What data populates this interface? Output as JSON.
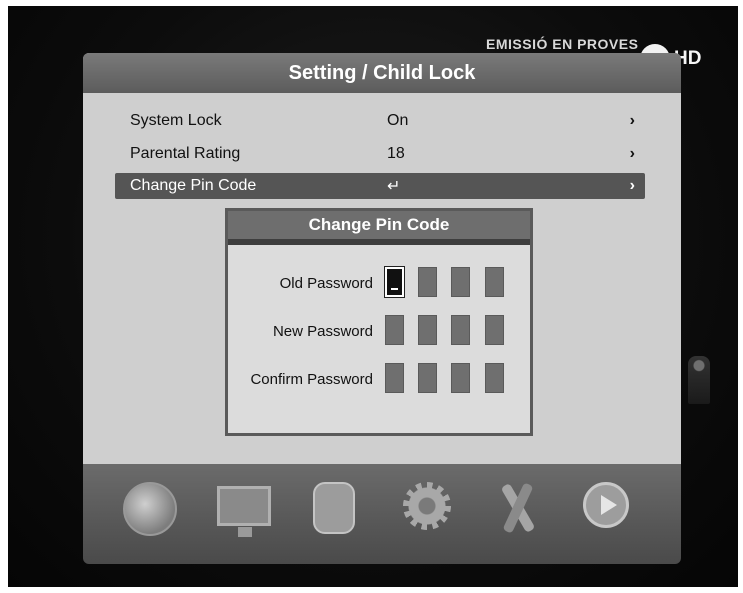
{
  "broadcast_text": "EMISSIÓ EN PROVES",
  "channel_badge": "HD",
  "panel": {
    "title": "Setting / Child Lock"
  },
  "menu": [
    {
      "label": "System Lock",
      "value": "On",
      "arrow": "›"
    },
    {
      "label": "Parental Rating",
      "value": "18",
      "arrow": "›"
    },
    {
      "label": "Change Pin Code",
      "value": "↵",
      "arrow": "›",
      "selected": true
    }
  ],
  "dialog": {
    "title": "Change Pin Code",
    "fields": [
      {
        "label": "Old Password"
      },
      {
        "label": "New Password"
      },
      {
        "label": "Confirm Password"
      }
    ]
  },
  "bottom_icons": [
    "globe-icon",
    "tv-icon",
    "film-icon",
    "gear-icon",
    "tools-icon",
    "play-icon"
  ],
  "colors": {
    "panel_bg": "#cfcfcf",
    "header_bg": "#6b6b6b",
    "selected_row": "#555555"
  }
}
